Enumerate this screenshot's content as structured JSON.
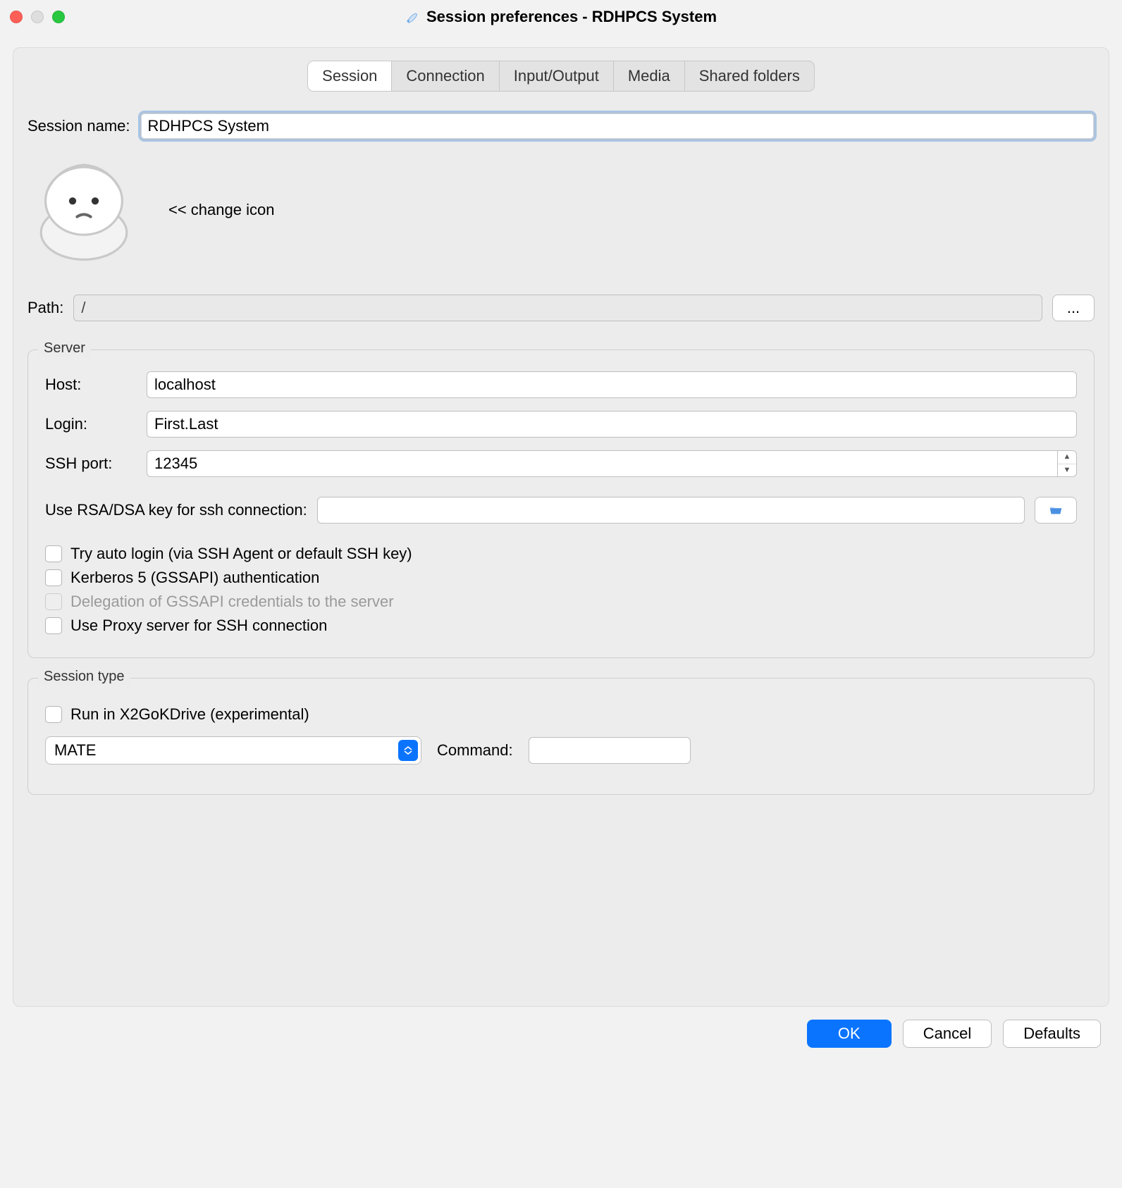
{
  "window": {
    "title": "Session preferences - RDHPCS System"
  },
  "tabs": {
    "items": [
      "Session",
      "Connection",
      "Input/Output",
      "Media",
      "Shared folders"
    ],
    "active_index": 0
  },
  "session": {
    "session_name_label": "Session name:",
    "session_name_value": "RDHPCS System",
    "change_icon_hint": "<< change icon",
    "path_label": "Path:",
    "path_value": "/",
    "path_browse_label": "..."
  },
  "server": {
    "group_title": "Server",
    "host_label": "Host:",
    "host_value": "localhost",
    "login_label": "Login:",
    "login_value": "First.Last",
    "ssh_port_label": "SSH port:",
    "ssh_port_value": "12345",
    "rsa_key_label": "Use RSA/DSA key for ssh connection:",
    "rsa_key_value": "",
    "checks": {
      "auto_login": "Try auto login (via SSH Agent or default SSH key)",
      "kerberos": "Kerberos 5 (GSSAPI) authentication",
      "delegation": "Delegation of GSSAPI credentials to the server",
      "proxy": "Use Proxy server for SSH connection"
    }
  },
  "session_type": {
    "group_title": "Session type",
    "x2go_kdrive_label": "Run in X2GoKDrive (experimental)",
    "select_value": "MATE",
    "command_label": "Command:",
    "command_value": ""
  },
  "buttons": {
    "ok": "OK",
    "cancel": "Cancel",
    "defaults": "Defaults"
  }
}
